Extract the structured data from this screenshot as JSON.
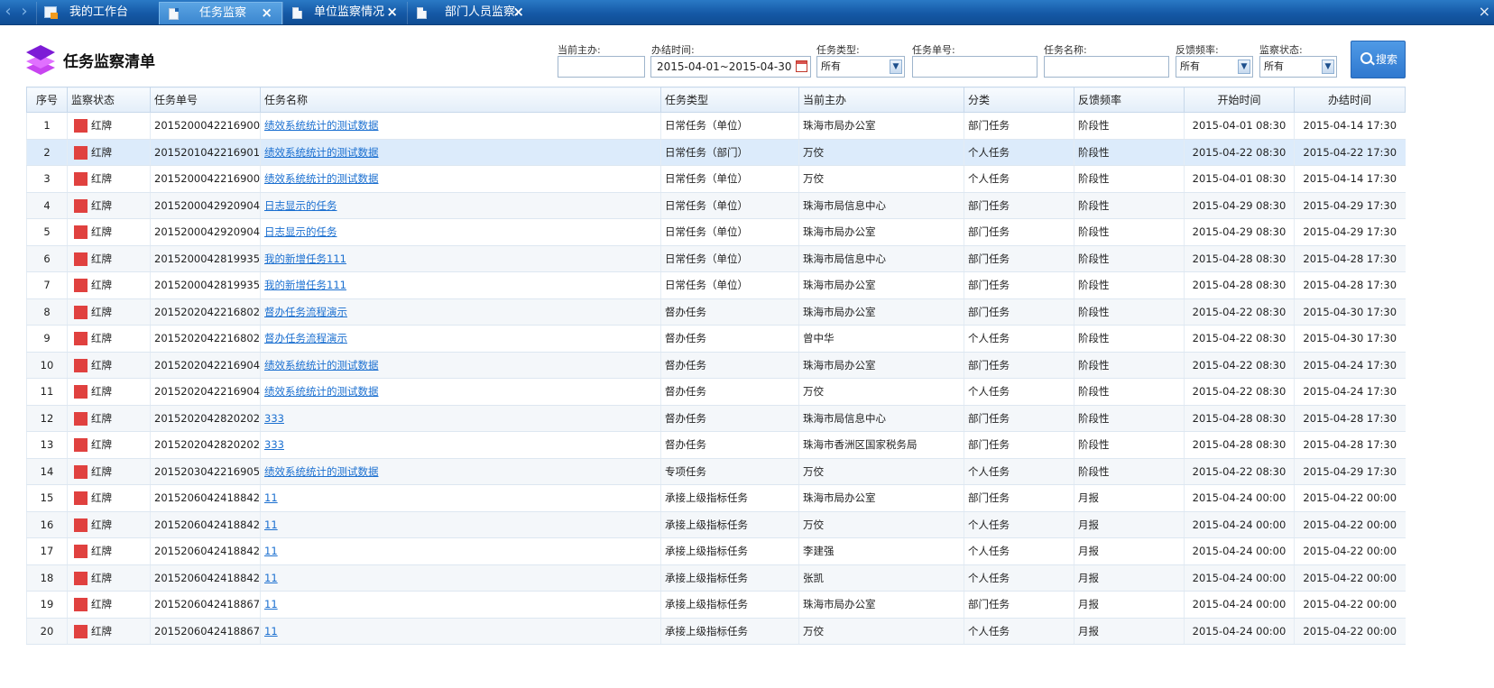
{
  "tabs": [
    {
      "label": "我的工作台"
    },
    {
      "label": "任务监察"
    },
    {
      "label": "单位监察情况"
    },
    {
      "label": "部门人员监察."
    }
  ],
  "page_title": "任务监察清单",
  "filters": {
    "current_handler": {
      "label": "当前主办:",
      "value": ""
    },
    "deadline": {
      "label": "办结时间:",
      "value": "2015-04-01~2015-04-30"
    },
    "task_type": {
      "label": "任务类型:",
      "value": "所有"
    },
    "task_no": {
      "label": "任务单号:",
      "value": ""
    },
    "task_name": {
      "label": "任务名称:",
      "value": ""
    },
    "feedback_freq": {
      "label": "反馈频率:",
      "value": "所有"
    },
    "watch_status": {
      "label": "监察状态:",
      "value": "所有"
    },
    "search_label": "搜索"
  },
  "columns": [
    "序号",
    "监察状态",
    "任务单号",
    "任务名称",
    "任务类型",
    "当前主办",
    "分类",
    "反馈频率",
    "开始时间",
    "办结时间"
  ],
  "rows": [
    {
      "no": "1",
      "status": "红牌",
      "task_no": "2015200042216900",
      "name": "绩效系统统计的测试数据",
      "type": "日常任务（单位）",
      "handler": "珠海市局办公室",
      "category": "部门任务",
      "freq": "阶段性",
      "start": "2015-04-01 08:30",
      "end": "2015-04-14 17:30"
    },
    {
      "no": "2",
      "status": "红牌",
      "task_no": "2015201042216901",
      "name": "绩效系统统计的测试数据",
      "type": "日常任务（部门）",
      "handler": "万佼",
      "category": "个人任务",
      "freq": "阶段性",
      "start": "2015-04-22 08:30",
      "end": "2015-04-22 17:30"
    },
    {
      "no": "3",
      "status": "红牌",
      "task_no": "2015200042216900",
      "name": "绩效系统统计的测试数据",
      "type": "日常任务（单位）",
      "handler": "万佼",
      "category": "个人任务",
      "freq": "阶段性",
      "start": "2015-04-01 08:30",
      "end": "2015-04-14 17:30"
    },
    {
      "no": "4",
      "status": "红牌",
      "task_no": "2015200042920904",
      "name": "日志显示的任务",
      "type": "日常任务（单位）",
      "handler": "珠海市局信息中心",
      "category": "部门任务",
      "freq": "阶段性",
      "start": "2015-04-29 08:30",
      "end": "2015-04-29 17:30"
    },
    {
      "no": "5",
      "status": "红牌",
      "task_no": "2015200042920904",
      "name": "日志显示的任务",
      "type": "日常任务（单位）",
      "handler": "珠海市局办公室",
      "category": "部门任务",
      "freq": "阶段性",
      "start": "2015-04-29 08:30",
      "end": "2015-04-29 17:30"
    },
    {
      "no": "6",
      "status": "红牌",
      "task_no": "2015200042819935",
      "name": "我的新增任务111",
      "type": "日常任务（单位）",
      "handler": "珠海市局信息中心",
      "category": "部门任务",
      "freq": "阶段性",
      "start": "2015-04-28 08:30",
      "end": "2015-04-28 17:30"
    },
    {
      "no": "7",
      "status": "红牌",
      "task_no": "2015200042819935",
      "name": "我的新增任务111",
      "type": "日常任务（单位）",
      "handler": "珠海市局办公室",
      "category": "部门任务",
      "freq": "阶段性",
      "start": "2015-04-28 08:30",
      "end": "2015-04-28 17:30"
    },
    {
      "no": "8",
      "status": "红牌",
      "task_no": "2015202042216802",
      "name": "督办任务流程演示",
      "type": "督办任务",
      "handler": "珠海市局办公室",
      "category": "部门任务",
      "freq": "阶段性",
      "start": "2015-04-22 08:30",
      "end": "2015-04-30 17:30"
    },
    {
      "no": "9",
      "status": "红牌",
      "task_no": "2015202042216802",
      "name": "督办任务流程演示",
      "type": "督办任务",
      "handler": "曾中华",
      "category": "个人任务",
      "freq": "阶段性",
      "start": "2015-04-22 08:30",
      "end": "2015-04-30 17:30"
    },
    {
      "no": "10",
      "status": "红牌",
      "task_no": "2015202042216904",
      "name": "绩效系统统计的测试数据",
      "type": "督办任务",
      "handler": "珠海市局办公室",
      "category": "部门任务",
      "freq": "阶段性",
      "start": "2015-04-22 08:30",
      "end": "2015-04-24 17:30"
    },
    {
      "no": "11",
      "status": "红牌",
      "task_no": "2015202042216904",
      "name": "绩效系统统计的测试数据",
      "type": "督办任务",
      "handler": "万佼",
      "category": "个人任务",
      "freq": "阶段性",
      "start": "2015-04-22 08:30",
      "end": "2015-04-24 17:30"
    },
    {
      "no": "12",
      "status": "红牌",
      "task_no": "2015202042820202",
      "name": "333",
      "type": "督办任务",
      "handler": "珠海市局信息中心",
      "category": "部门任务",
      "freq": "阶段性",
      "start": "2015-04-28 08:30",
      "end": "2015-04-28 17:30"
    },
    {
      "no": "13",
      "status": "红牌",
      "task_no": "2015202042820202",
      "name": "333",
      "type": "督办任务",
      "handler": "珠海市香洲区国家税务局",
      "category": "部门任务",
      "freq": "阶段性",
      "start": "2015-04-28 08:30",
      "end": "2015-04-28 17:30"
    },
    {
      "no": "14",
      "status": "红牌",
      "task_no": "2015203042216905",
      "name": "绩效系统统计的测试数据",
      "type": "专项任务",
      "handler": "万佼",
      "category": "个人任务",
      "freq": "阶段性",
      "start": "2015-04-22 08:30",
      "end": "2015-04-29 17:30"
    },
    {
      "no": "15",
      "status": "红牌",
      "task_no": "2015206042418842",
      "name": "11",
      "type": "承接上级指标任务",
      "handler": "珠海市局办公室",
      "category": "部门任务",
      "freq": "月报",
      "start": "2015-04-24 00:00",
      "end": "2015-04-22 00:00"
    },
    {
      "no": "16",
      "status": "红牌",
      "task_no": "2015206042418842",
      "name": "11",
      "type": "承接上级指标任务",
      "handler": "万佼",
      "category": "个人任务",
      "freq": "月报",
      "start": "2015-04-24 00:00",
      "end": "2015-04-22 00:00"
    },
    {
      "no": "17",
      "status": "红牌",
      "task_no": "2015206042418842",
      "name": "11",
      "type": "承接上级指标任务",
      "handler": "李建强",
      "category": "个人任务",
      "freq": "月报",
      "start": "2015-04-24 00:00",
      "end": "2015-04-22 00:00"
    },
    {
      "no": "18",
      "status": "红牌",
      "task_no": "2015206042418842",
      "name": "11",
      "type": "承接上级指标任务",
      "handler": "张凯",
      "category": "个人任务",
      "freq": "月报",
      "start": "2015-04-24 00:00",
      "end": "2015-04-22 00:00"
    },
    {
      "no": "19",
      "status": "红牌",
      "task_no": "2015206042418867",
      "name": "11",
      "type": "承接上级指标任务",
      "handler": "珠海市局办公室",
      "category": "部门任务",
      "freq": "月报",
      "start": "2015-04-24 00:00",
      "end": "2015-04-22 00:00"
    },
    {
      "no": "20",
      "status": "红牌",
      "task_no": "2015206042418867",
      "name": "11",
      "type": "承接上级指标任务",
      "handler": "万佼",
      "category": "个人任务",
      "freq": "月报",
      "start": "2015-04-24 00:00",
      "end": "2015-04-22 00:00"
    }
  ],
  "colors": {
    "red_tag": "#e0413f",
    "link": "#1a6fd0",
    "tabbar": "#1559a6",
    "selected_row": "#dcebfb"
  }
}
